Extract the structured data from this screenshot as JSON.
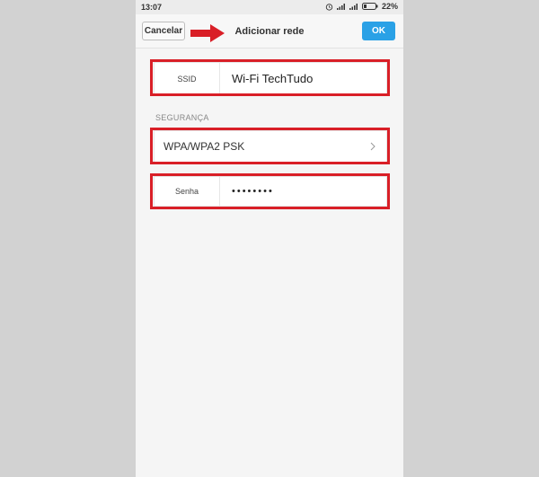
{
  "status_bar": {
    "time": "13:07",
    "battery": "22%",
    "icons": [
      "alarm-icon",
      "signal-icon",
      "signal-icon",
      "battery-icon"
    ]
  },
  "header": {
    "cancel_label": "Cancelar",
    "title": "Adicionar rede",
    "ok_label": "OK"
  },
  "form": {
    "ssid_label": "SSID",
    "ssid_value": "Wi-Fi TechTudo",
    "security_section_label": "SEGURANÇA",
    "security_value": "WPA/WPA2 PSK",
    "password_label": "Senha",
    "password_value": "••••••••"
  },
  "colors": {
    "accent": "#2aa1e6",
    "highlight": "#d91f27"
  }
}
